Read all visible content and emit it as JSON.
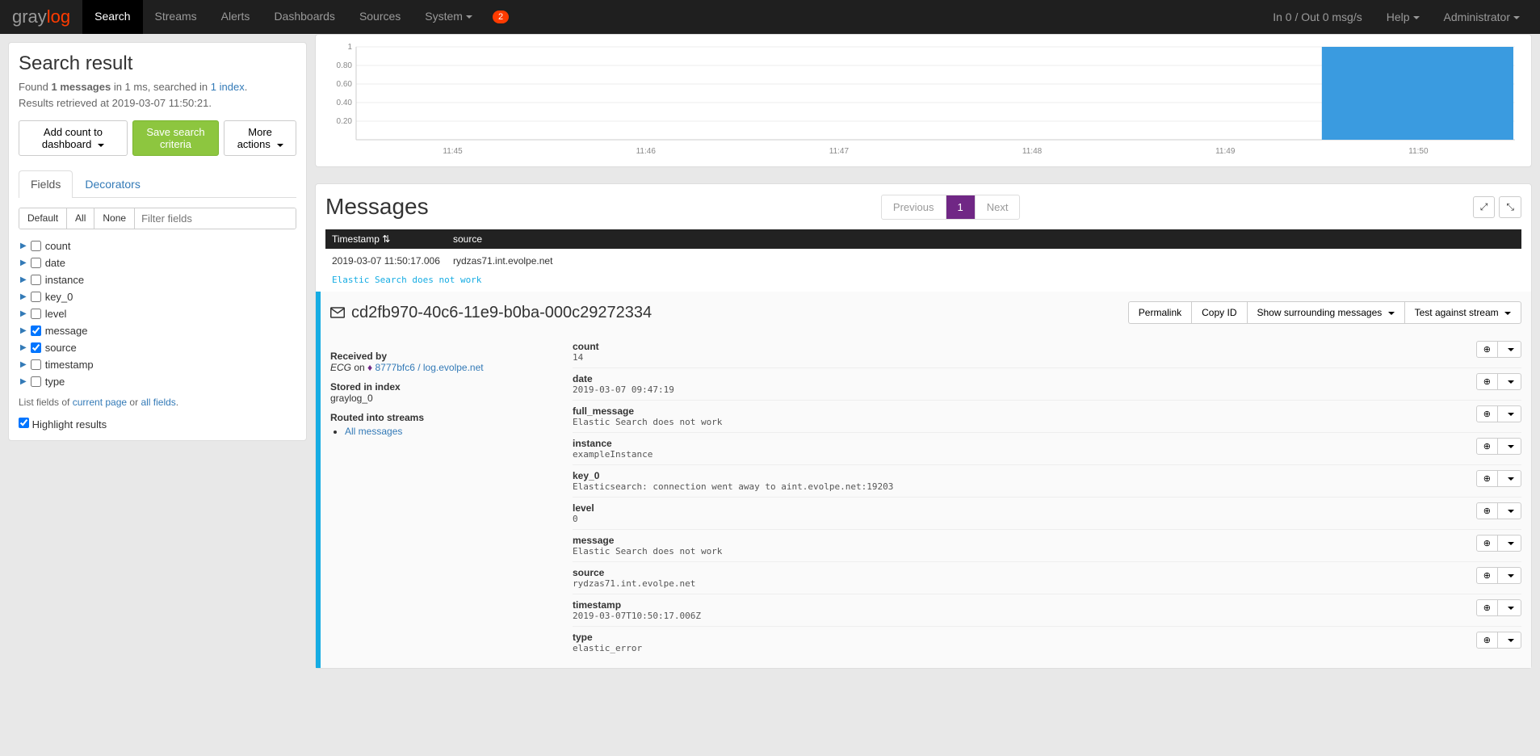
{
  "navbar": {
    "brand_gray": "gray",
    "brand_log": "log",
    "items": [
      "Search",
      "Streams",
      "Alerts",
      "Dashboards",
      "Sources",
      "System"
    ],
    "notification_count": "2",
    "io_text": "In 0 / Out 0 msg/s",
    "help": "Help",
    "admin": "Administrator"
  },
  "sidebar": {
    "title": "Search result",
    "found_prefix": "Found ",
    "found_count": "1 messages",
    "found_mid": " in 1 ms, searched in ",
    "found_link": "1 index",
    "retrieved": "Results retrieved at 2019-03-07 11:50:21.",
    "btn_dashboard": "Add count to dashboard",
    "btn_save": "Save search criteria",
    "btn_more": "More actions",
    "tab_fields": "Fields",
    "tab_decorators": "Decorators",
    "filter_default": "Default",
    "filter_all": "All",
    "filter_none": "None",
    "filter_placeholder": "Filter fields",
    "fields": [
      {
        "name": "count",
        "checked": false
      },
      {
        "name": "date",
        "checked": false
      },
      {
        "name": "instance",
        "checked": false
      },
      {
        "name": "key_0",
        "checked": false
      },
      {
        "name": "level",
        "checked": false
      },
      {
        "name": "message",
        "checked": true
      },
      {
        "name": "source",
        "checked": true
      },
      {
        "name": "timestamp",
        "checked": false
      },
      {
        "name": "type",
        "checked": false
      }
    ],
    "list_fields_prefix": "List fields of ",
    "list_fields_current": "current page",
    "list_fields_or": " or ",
    "list_fields_all": "all fields",
    "highlight": "Highlight results"
  },
  "chart_data": {
    "type": "bar",
    "categories": [
      "11:45",
      "11:46",
      "11:47",
      "11:48",
      "11:49",
      "11:50"
    ],
    "values": [
      0,
      0,
      0,
      0,
      0,
      1
    ],
    "yticks": [
      0.2,
      0.4,
      0.6,
      0.8,
      1
    ],
    "ylim": [
      0,
      1
    ]
  },
  "messages": {
    "title": "Messages",
    "prev": "Previous",
    "page": "1",
    "next": "Next",
    "th_timestamp": "Timestamp",
    "th_source": "source",
    "row_ts": "2019-03-07 11:50:17.006",
    "row_src": "rydzas71.int.evolpe.net",
    "row_msg": "Elastic Search does not work",
    "msg_id": "cd2fb970-40c6-11e9-b0ba-000c29272334",
    "btn_permalink": "Permalink",
    "btn_copyid": "Copy ID",
    "btn_surrounding": "Show surrounding messages",
    "btn_testagainst": "Test against stream",
    "received_by_label": "Received by",
    "received_by_ecg": "ECG",
    "received_by_on": " on ",
    "received_by_node": "8777bfc6 / log.evolpe.net",
    "stored_label": "Stored in index",
    "stored_value": "graylog_0",
    "routed_label": "Routed into streams",
    "routed_stream": "All messages",
    "detail_fields": [
      {
        "name": "count",
        "value": "14"
      },
      {
        "name": "date",
        "value": "2019-03-07 09:47:19"
      },
      {
        "name": "full_message",
        "value": "Elastic Search does not work"
      },
      {
        "name": "instance",
        "value": "exampleInstance"
      },
      {
        "name": "key_0",
        "value": "Elasticsearch: connection went away to aint.evolpe.net:19203"
      },
      {
        "name": "level",
        "value": "0"
      },
      {
        "name": "message",
        "value": "Elastic Search does not work"
      },
      {
        "name": "source",
        "value": "rydzas71.int.evolpe.net"
      },
      {
        "name": "timestamp",
        "value": "2019-03-07T10:50:17.006Z"
      },
      {
        "name": "type",
        "value": "elastic_error"
      }
    ]
  }
}
